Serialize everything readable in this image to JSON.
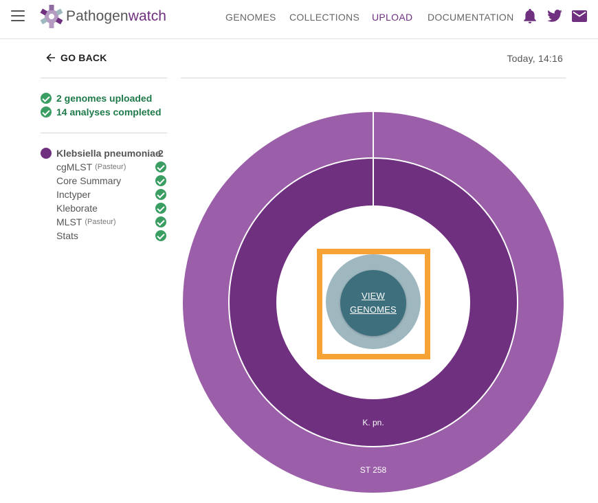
{
  "header": {
    "logo_part1": "Pathogen",
    "logo_part2": "watch",
    "nav": [
      "GENOMES",
      "COLLECTIONS",
      "UPLOAD",
      "DOCUMENTATION"
    ],
    "active_nav": "UPLOAD",
    "icons": [
      "menu-icon",
      "bell-icon",
      "twitter-icon",
      "mail-icon"
    ],
    "brand_color": "#6e307f"
  },
  "back_label": "GO BACK",
  "timestamp": "Today, 14:16",
  "summary": {
    "uploaded": "2 genomes uploaded",
    "completed": "14 analyses completed"
  },
  "organism": {
    "name": "Klebsiella pneumoniae",
    "count": "2",
    "tasks": [
      {
        "name": "cgMLST",
        "sub": "(Pasteur)"
      },
      {
        "name": "Core Summary",
        "sub": ""
      },
      {
        "name": "Inctyper",
        "sub": ""
      },
      {
        "name": "Kleborate",
        "sub": ""
      },
      {
        "name": "MLST",
        "sub": "(Pasteur)"
      },
      {
        "name": "Stats",
        "sub": ""
      }
    ]
  },
  "chart_data": {
    "type": "pie",
    "rings": [
      {
        "level": "species",
        "segments": [
          {
            "label": "K. pn.",
            "value": 2
          }
        ],
        "color": "#6e307f"
      },
      {
        "level": "sequence type",
        "segments": [
          {
            "label": "ST 258",
            "value": 2
          }
        ],
        "color": "#9b5ea8"
      }
    ]
  },
  "view_genomes": {
    "line1": "VIEW",
    "line2": "GENOMES"
  }
}
